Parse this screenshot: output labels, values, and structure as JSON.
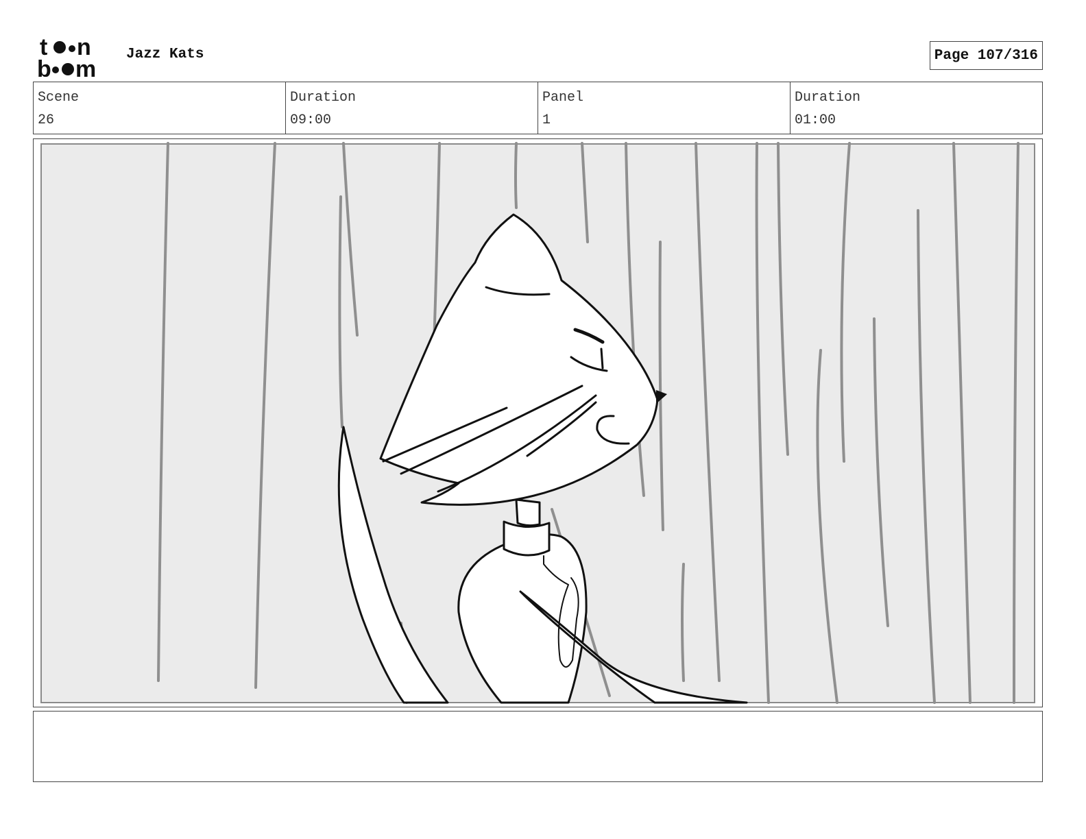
{
  "header": {
    "logo_alt": "toon boom",
    "project_title": "Jazz Kats",
    "page_label": "Page 107/316"
  },
  "info": {
    "scene_label": "Scene",
    "scene_value": "26",
    "scene_duration_label": "Duration",
    "scene_duration_value": "09:00",
    "panel_label": "Panel",
    "panel_value": "1",
    "panel_duration_label": "Duration",
    "panel_duration_value": "01:00"
  },
  "notes": {
    "text": ""
  }
}
